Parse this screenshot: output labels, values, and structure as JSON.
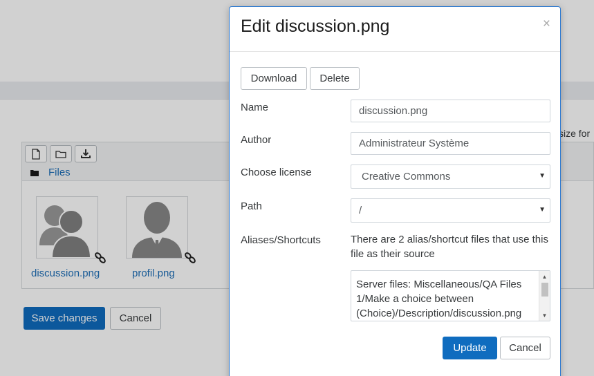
{
  "background": {
    "size_hint": "size for",
    "toolbar": {
      "icons": [
        "file-icon",
        "folder-icon",
        "download-icon"
      ]
    },
    "breadcrumb": {
      "label": "Files"
    },
    "files": [
      {
        "name": "discussion.png",
        "icon": "group-avatar-icon"
      },
      {
        "name": "profil.png",
        "icon": "user-avatar-icon"
      }
    ],
    "save_label": "Save changes",
    "cancel_label": "Cancel",
    "accent_color": "#0f6cbf"
  },
  "modal": {
    "title": "Edit discussion.png",
    "close_symbol": "×",
    "download_label": "Download",
    "delete_label": "Delete",
    "fields": {
      "name_label": "Name",
      "name_value": "discussion.png",
      "author_label": "Author",
      "author_value": "Administrateur Système",
      "license_label": "Choose license",
      "license_value": "Creative Commons",
      "path_label": "Path",
      "path_value": "/",
      "aliases_label": "Aliases/Shortcuts",
      "aliases_text": "There are 2 alias/shortcut files that use this file as their source",
      "aliases_list": "Server files: Miscellaneous/QA Files 1/Make a choice between (Choice)/Description/discussion.png"
    },
    "update_label": "Update",
    "cancel_label": "Cancel"
  }
}
